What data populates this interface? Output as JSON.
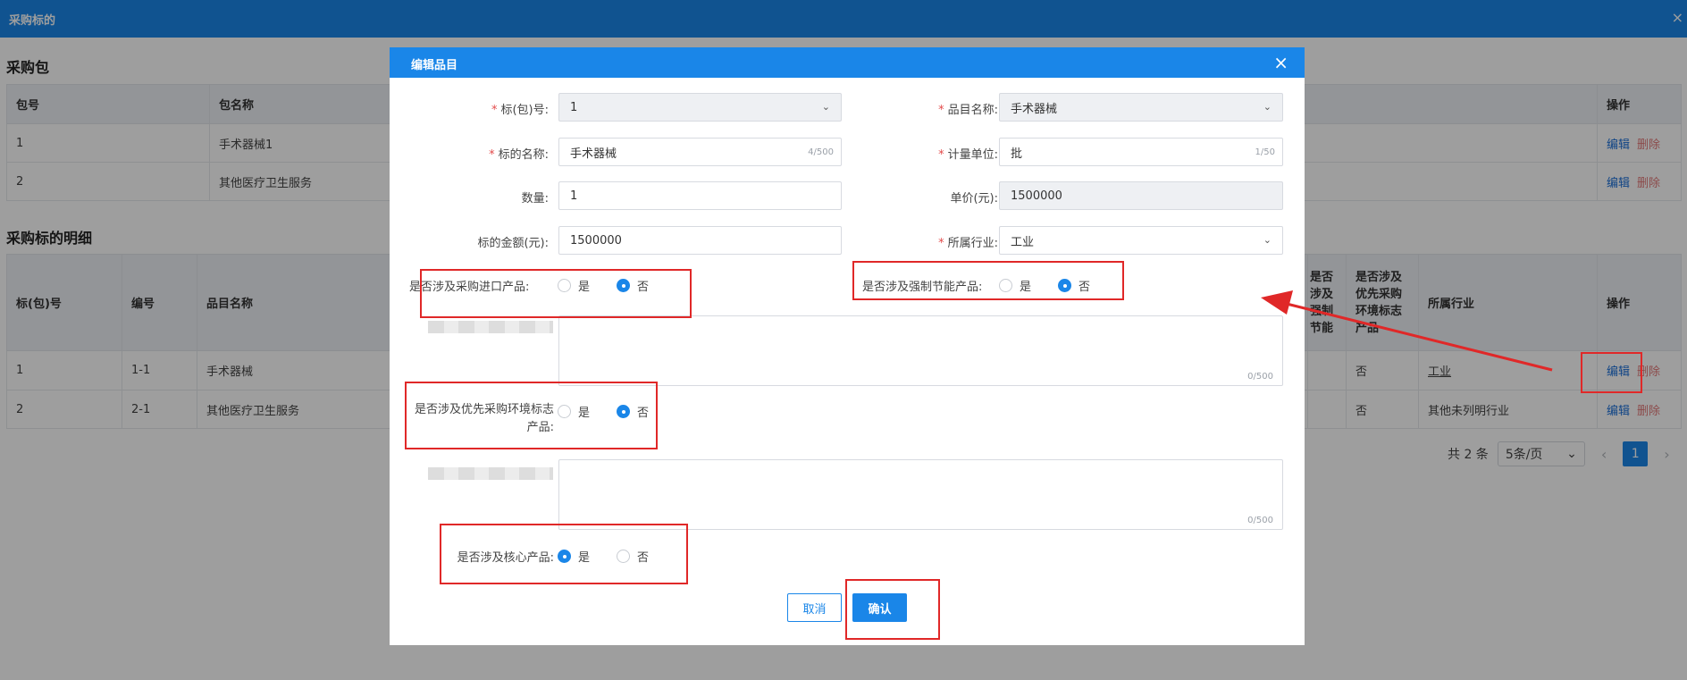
{
  "window": {
    "title": "采购标的",
    "close": "×"
  },
  "packages": {
    "title": "采购包",
    "headers": [
      "包号",
      "包名称",
      "操作"
    ],
    "rows": [
      {
        "no": "1",
        "name": "手术器械1",
        "edit": "编辑",
        "delete": "删除"
      },
      {
        "no": "2",
        "name": "其他医疗卫生服务",
        "edit": "编辑",
        "delete": "删除"
      }
    ]
  },
  "details": {
    "title": "采购标的明细",
    "headers": {
      "pkg": "标(包)号",
      "code": "编号",
      "item": "品目名称",
      "energy": "是否涉及强制节能",
      "env": "是否涉及优先采购环境标志产品",
      "industry": "所属行业",
      "ops": "操作"
    },
    "rows": [
      {
        "pkg": "1",
        "code": "1-1",
        "item": "手术器械",
        "env": "否",
        "industry": "工业",
        "edit": "编辑",
        "delete": "删除"
      },
      {
        "pkg": "2",
        "code": "2-1",
        "item": "其他医疗卫生服务",
        "env": "否",
        "industry": "其他未列明行业",
        "edit": "编辑",
        "delete": "删除"
      }
    ]
  },
  "pagination": {
    "total": "共 2 条",
    "page_size": "5条/页",
    "current_page": "1",
    "prev": "‹",
    "next": "›"
  },
  "modal": {
    "title": "编辑品目",
    "close": "×",
    "fields": {
      "pkg_no": {
        "label": "标(包)号:",
        "value": "1"
      },
      "item_name": {
        "label": "品目名称:",
        "value": "手术器械"
      },
      "subject_name": {
        "label": "标的名称:",
        "value": "手术器械",
        "count": "4/500"
      },
      "unit": {
        "label": "计量单位:",
        "value": "批",
        "count": "1/50"
      },
      "quantity": {
        "label": "数量:",
        "value": "1"
      },
      "unit_price": {
        "label": "单价(元):",
        "value": "1500000"
      },
      "amount": {
        "label": "标的金额(元):",
        "value": "1500000"
      },
      "industry": {
        "label": "所属行业:",
        "value": "工业"
      }
    },
    "radios": {
      "import": {
        "label": "是否涉及采购进口产品:",
        "yes": "是",
        "no": "否",
        "selected": "no"
      },
      "energy": {
        "label": "是否涉及强制节能产品:",
        "yes": "是",
        "no": "否",
        "selected": "no"
      },
      "env": {
        "label": "是否涉及优先采购环境标志产品:",
        "yes": "是",
        "no": "否",
        "selected": "no"
      },
      "core": {
        "label": "是否涉及核心产品:",
        "yes": "是",
        "no": "否",
        "selected": "yes"
      }
    },
    "textarea_counts": {
      "first": "0/500",
      "second": "0/500"
    },
    "buttons": {
      "cancel": "取消",
      "confirm": "确认"
    }
  },
  "colors": {
    "accent": "#1a86e8",
    "annotation": "#e02828",
    "required": "#e34b4b"
  }
}
